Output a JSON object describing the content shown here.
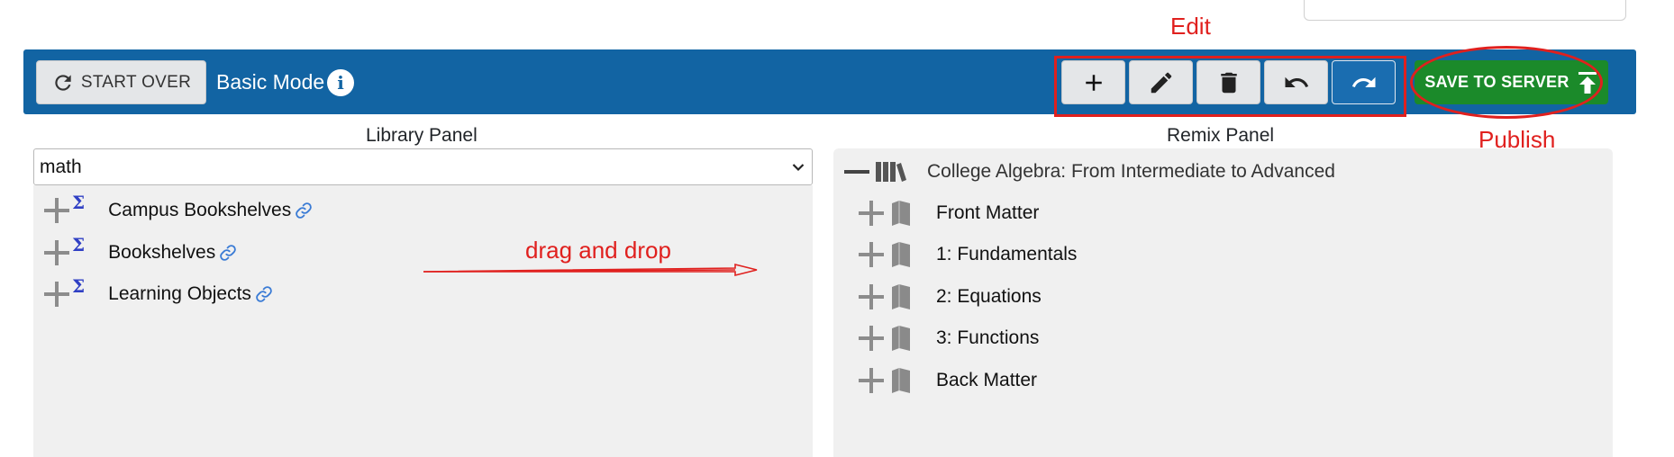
{
  "toolbar": {
    "start_over_label": "START OVER",
    "mode_label": "Basic Mode",
    "info_icon": "info-icon",
    "edit_buttons": [
      "plus-icon",
      "pencil-icon",
      "trash-icon",
      "undo-icon",
      "redo-icon"
    ],
    "save_label": "SAVE TO SERVER",
    "save_icon": "upload-icon",
    "colors": {
      "bar": "#1264a3",
      "save": "#1b8a2a"
    }
  },
  "annotations": {
    "edit": "Edit",
    "publish": "Publish",
    "drag": "drag and drop",
    "color": "#e0201e"
  },
  "library": {
    "title": "Library Panel",
    "select_value": "math",
    "items": [
      {
        "label": "Campus Bookshelves"
      },
      {
        "label": "Bookshelves"
      },
      {
        "label": "Learning Objects"
      }
    ]
  },
  "remix": {
    "title": "Remix Panel",
    "root": "College Algebra: From Intermediate to Advanced",
    "items": [
      {
        "label": "Front Matter"
      },
      {
        "label": "1: Fundamentals"
      },
      {
        "label": "2: Equations"
      },
      {
        "label": "3: Functions"
      },
      {
        "label": "Back Matter"
      }
    ]
  }
}
